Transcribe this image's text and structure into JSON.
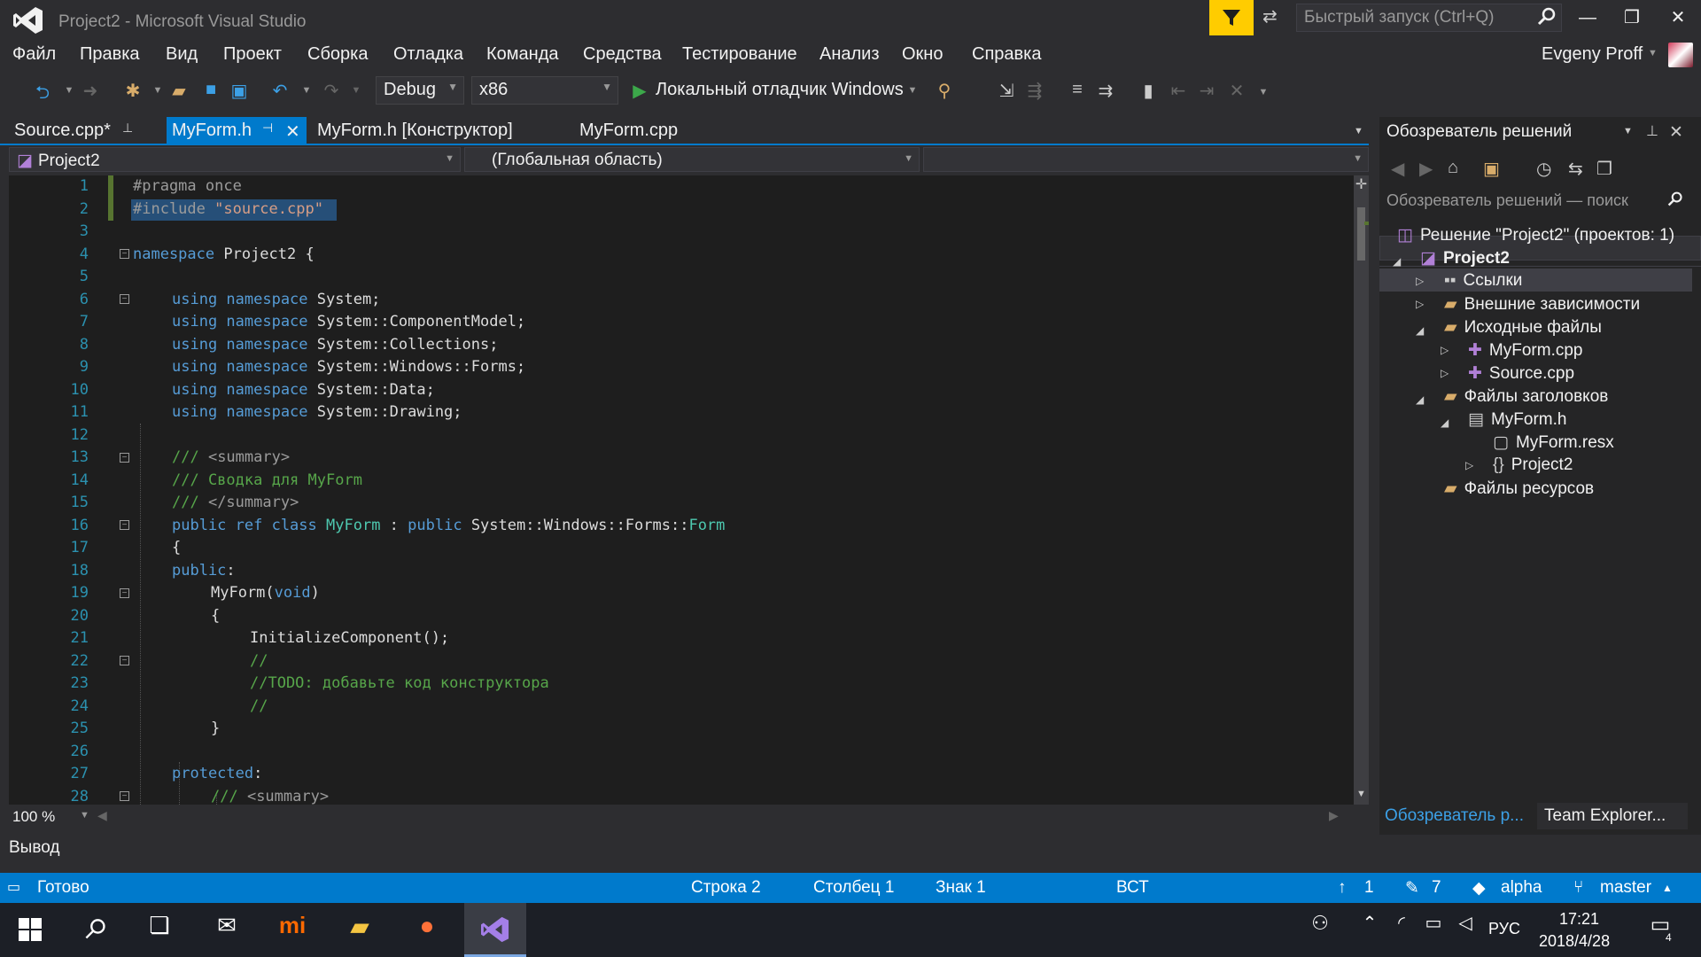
{
  "window": {
    "title": "Project2 - Microsoft Visual Studio",
    "quick_launch_placeholder": "Быстрый запуск (Ctrl+Q)",
    "minimize": "—",
    "restore": "❐",
    "close": "✕"
  },
  "menu": [
    "Файл",
    "Правка",
    "Вид",
    "Проект",
    "Сборка",
    "Отладка",
    "Команда",
    "Средства",
    "Тестирование",
    "Анализ",
    "Окно",
    "Справка"
  ],
  "user": {
    "name": "Evgeny Proff"
  },
  "toolbar": {
    "config": "Debug",
    "platform": "x86",
    "run_label": "Локальный отладчик Windows"
  },
  "tabs": [
    {
      "label": "Source.cpp*"
    },
    {
      "label": "MyForm.h"
    },
    {
      "label": "MyForm.h [Конструктор]"
    },
    {
      "label": "MyForm.cpp"
    }
  ],
  "nav": {
    "project": "Project2",
    "scope": "(Глобальная область)",
    "member": ""
  },
  "editor": {
    "line_numbers": [
      "1",
      "2",
      "3",
      "4",
      "5",
      "6",
      "7",
      "8",
      "9",
      "10",
      "11",
      "12",
      "13",
      "14",
      "15",
      "16",
      "17",
      "18",
      "19",
      "20",
      "21",
      "22",
      "23",
      "24",
      "25",
      "26",
      "27",
      "28"
    ],
    "zoom": "100 %"
  },
  "output_label": "Вывод",
  "solution_explorer": {
    "title": "Обозреватель решений",
    "search_placeholder": "Обозреватель решений — поиск",
    "items": [
      {
        "label": "Решение \"Project2\"  (проектов: 1)"
      },
      {
        "label": "Project2"
      },
      {
        "label": "Ссылки"
      },
      {
        "label": "Внешние зависимости"
      },
      {
        "label": "Исходные файлы"
      },
      {
        "label": "MyForm.cpp"
      },
      {
        "label": "Source.cpp"
      },
      {
        "label": "Файлы заголовков"
      },
      {
        "label": "MyForm.h"
      },
      {
        "label": "MyForm.resx"
      },
      {
        "label": "Project2"
      },
      {
        "label": "Файлы ресурсов"
      }
    ],
    "tab_solution": "Обозреватель р...",
    "tab_team": "Team Explorer..."
  },
  "status": {
    "ready": "Готово",
    "line": "Строка 2",
    "col": "Столбец 1",
    "char": "Знак 1",
    "mode": "ВСТ",
    "up_count": "1",
    "edit_count": "7",
    "repo": "alpha",
    "branch": "master"
  },
  "taskbar": {
    "lang": "РУС",
    "time": "17:21",
    "date": "2018/4/28",
    "notif_count": "4"
  },
  "colors": {
    "accent": "#007acc",
    "editor_bg": "#1e1e1e",
    "keyword": "#569cd6",
    "type": "#4ec9b0",
    "comment": "#57a64a",
    "line_number": "#2b91af"
  }
}
